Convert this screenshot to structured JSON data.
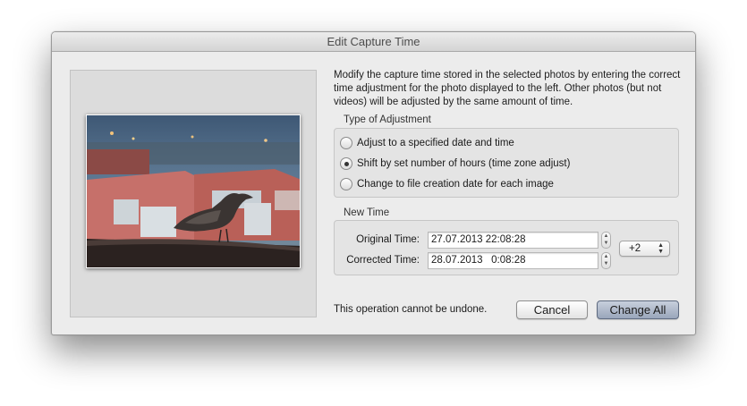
{
  "window": {
    "title": "Edit Capture Time"
  },
  "description": "Modify the capture time stored in the selected photos by entering the correct time adjustment for the photo displayed to the left. Other photos (but not videos) will be adjusted by the same amount of time.",
  "adjustment": {
    "label": "Type of Adjustment",
    "options": [
      {
        "label": "Adjust to a specified date and time",
        "checked": false
      },
      {
        "label": "Shift by set number of hours (time zone adjust)",
        "checked": true
      },
      {
        "label": "Change to file creation date for each image",
        "checked": false
      }
    ]
  },
  "new_time": {
    "label": "New Time",
    "original_label": "Original Time:",
    "original_value": "27.07.2013 22:08:28",
    "corrected_label": "Corrected Time:",
    "corrected_value": "28.07.2013   0:08:28",
    "hour_shift": "+2"
  },
  "footer": {
    "warning": "This operation cannot be undone.",
    "cancel_label": "Cancel",
    "change_all_label": "Change All"
  },
  "icons": {
    "stepper": "stepper-arrows-icon",
    "select": "select-arrows-icon"
  },
  "colors": {
    "primary_button": "#9aa6bb"
  }
}
